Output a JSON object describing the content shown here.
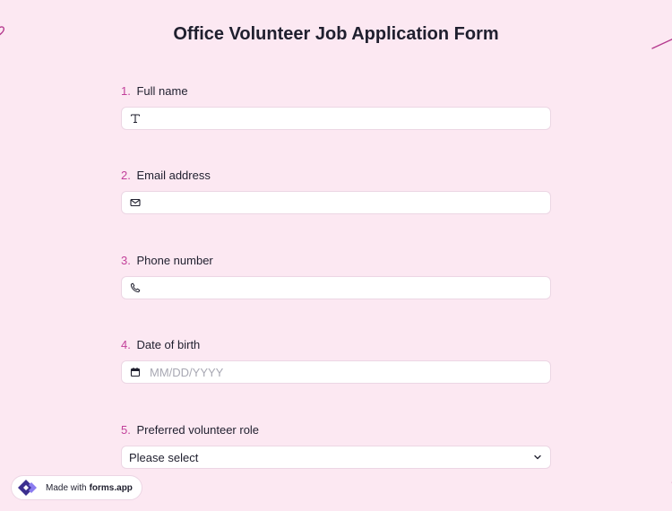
{
  "form": {
    "title": "Office Volunteer Job Application Form"
  },
  "questions": [
    {
      "number": "1.",
      "label": "Full name",
      "icon": "text-icon",
      "placeholder": ""
    },
    {
      "number": "2.",
      "label": "Email address",
      "icon": "mail-icon",
      "placeholder": ""
    },
    {
      "number": "3.",
      "label": "Phone number",
      "icon": "phone-icon",
      "placeholder": ""
    },
    {
      "number": "4.",
      "label": "Date of birth",
      "icon": "calendar-icon",
      "placeholder": "MM/DD/YYYY"
    },
    {
      "number": "5.",
      "label": "Preferred volunteer role",
      "icon": "chevron-down-icon",
      "selected": "Please select"
    }
  ],
  "badge": {
    "prefix": "Made with",
    "brand": "forms.app"
  },
  "colors": {
    "background": "#fce8f2",
    "accent": "#c2409a",
    "logo_dark": "#3b2f8f",
    "logo_light": "#8b7cf0"
  }
}
